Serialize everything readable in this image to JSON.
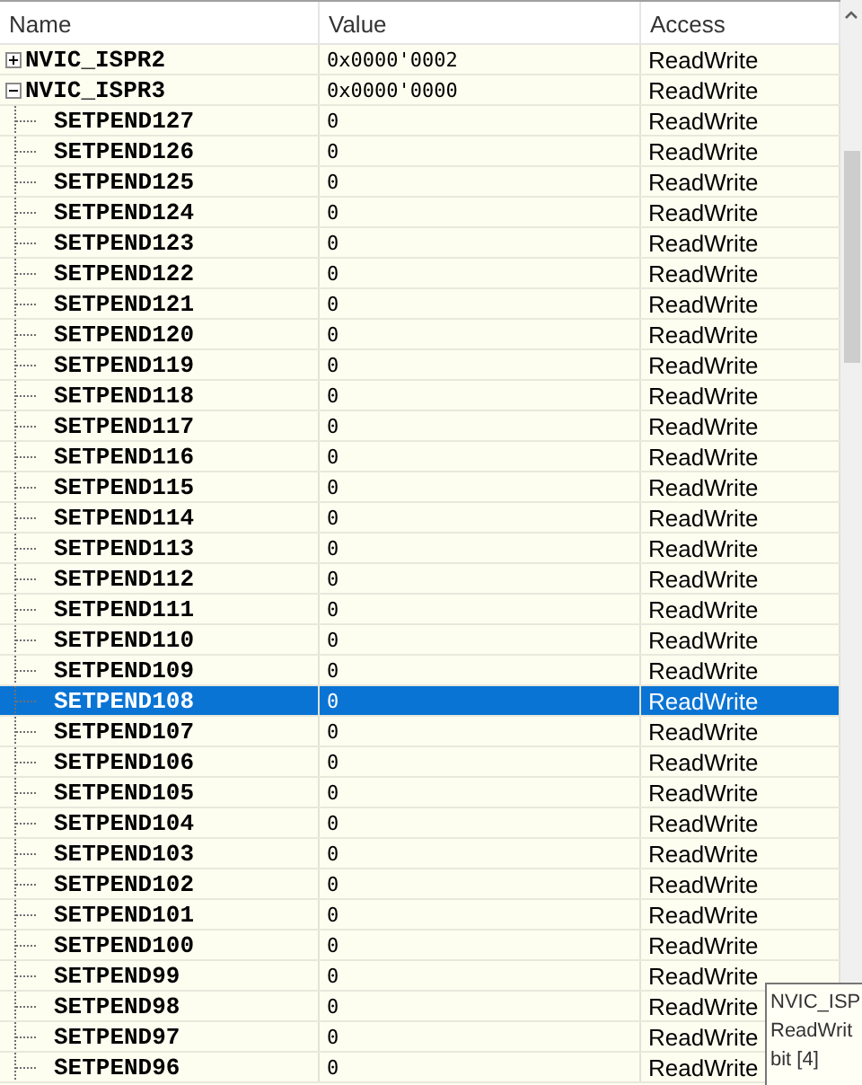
{
  "columns": [
    "Name",
    "Value",
    "Access"
  ],
  "registers": [
    {
      "name": "NVIC_ISPR2",
      "value": "0x0000'0002",
      "access": "ReadWrite",
      "expanded": false,
      "selected": false
    },
    {
      "name": "NVIC_ISPR3",
      "value": "0x0000'0000",
      "access": "ReadWrite",
      "expanded": true,
      "selected": false,
      "children": [
        {
          "name": "SETPEND127",
          "value": "0",
          "access": "ReadWrite",
          "selected": false
        },
        {
          "name": "SETPEND126",
          "value": "0",
          "access": "ReadWrite",
          "selected": false
        },
        {
          "name": "SETPEND125",
          "value": "0",
          "access": "ReadWrite",
          "selected": false
        },
        {
          "name": "SETPEND124",
          "value": "0",
          "access": "ReadWrite",
          "selected": false
        },
        {
          "name": "SETPEND123",
          "value": "0",
          "access": "ReadWrite",
          "selected": false
        },
        {
          "name": "SETPEND122",
          "value": "0",
          "access": "ReadWrite",
          "selected": false
        },
        {
          "name": "SETPEND121",
          "value": "0",
          "access": "ReadWrite",
          "selected": false
        },
        {
          "name": "SETPEND120",
          "value": "0",
          "access": "ReadWrite",
          "selected": false
        },
        {
          "name": "SETPEND119",
          "value": "0",
          "access": "ReadWrite",
          "selected": false
        },
        {
          "name": "SETPEND118",
          "value": "0",
          "access": "ReadWrite",
          "selected": false
        },
        {
          "name": "SETPEND117",
          "value": "0",
          "access": "ReadWrite",
          "selected": false
        },
        {
          "name": "SETPEND116",
          "value": "0",
          "access": "ReadWrite",
          "selected": false
        },
        {
          "name": "SETPEND115",
          "value": "0",
          "access": "ReadWrite",
          "selected": false
        },
        {
          "name": "SETPEND114",
          "value": "0",
          "access": "ReadWrite",
          "selected": false
        },
        {
          "name": "SETPEND113",
          "value": "0",
          "access": "ReadWrite",
          "selected": false
        },
        {
          "name": "SETPEND112",
          "value": "0",
          "access": "ReadWrite",
          "selected": false
        },
        {
          "name": "SETPEND111",
          "value": "0",
          "access": "ReadWrite",
          "selected": false
        },
        {
          "name": "SETPEND110",
          "value": "0",
          "access": "ReadWrite",
          "selected": false
        },
        {
          "name": "SETPEND109",
          "value": "0",
          "access": "ReadWrite",
          "selected": false
        },
        {
          "name": "SETPEND108",
          "value": "0",
          "access": "ReadWrite",
          "selected": true
        },
        {
          "name": "SETPEND107",
          "value": "0",
          "access": "ReadWrite",
          "selected": false
        },
        {
          "name": "SETPEND106",
          "value": "0",
          "access": "ReadWrite",
          "selected": false
        },
        {
          "name": "SETPEND105",
          "value": "0",
          "access": "ReadWrite",
          "selected": false
        },
        {
          "name": "SETPEND104",
          "value": "0",
          "access": "ReadWrite",
          "selected": false
        },
        {
          "name": "SETPEND103",
          "value": "0",
          "access": "ReadWrite",
          "selected": false
        },
        {
          "name": "SETPEND102",
          "value": "0",
          "access": "ReadWrite",
          "selected": false
        },
        {
          "name": "SETPEND101",
          "value": "0",
          "access": "ReadWrite",
          "selected": false
        },
        {
          "name": "SETPEND100",
          "value": "0",
          "access": "ReadWrite",
          "selected": false
        },
        {
          "name": "SETPEND99",
          "value": "0",
          "access": "ReadWrite",
          "selected": false
        },
        {
          "name": "SETPEND98",
          "value": "0",
          "access": "ReadWrite",
          "selected": false
        },
        {
          "name": "SETPEND97",
          "value": "0",
          "access": "ReadWrite",
          "selected": false
        },
        {
          "name": "SETPEND96",
          "value": "0",
          "access": "ReadWrite",
          "selected": false
        }
      ]
    }
  ],
  "tooltip": {
    "lines": [
      "NVIC_ISP",
      "ReadWrit",
      "bit [4]"
    ]
  }
}
